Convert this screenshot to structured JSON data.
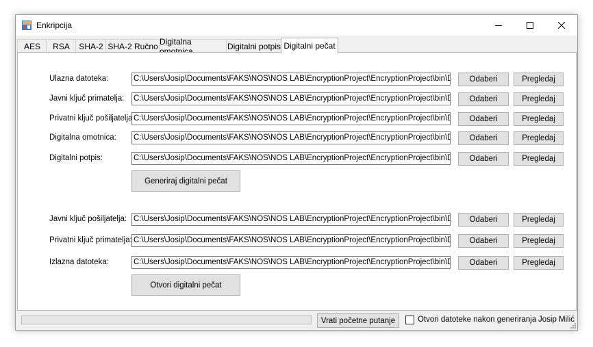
{
  "window": {
    "title": "Enkripcija"
  },
  "tabs": [
    {
      "label": "AES"
    },
    {
      "label": "RSA"
    },
    {
      "label": "SHA-2"
    },
    {
      "label": "SHA-2 Ručno"
    },
    {
      "label": "Digitalna omotnica"
    },
    {
      "label": "Digitalni potpis"
    },
    {
      "label": "Digitalni pečat"
    }
  ],
  "active_tab": "Digitalni pečat",
  "fields": [
    {
      "label": "Ulazna datoteka:",
      "value": "C:\\Users\\Josip\\Documents\\FAKS\\NOS\\NOS LAB\\EncryptionProject\\EncryptionProject\\bin\\Debug"
    },
    {
      "label": "Javni ključ primatelja:",
      "value": "C:\\Users\\Josip\\Documents\\FAKS\\NOS\\NOS LAB\\EncryptionProject\\EncryptionProject\\bin\\Debug"
    },
    {
      "label": "Privatni ključ pošiljatelja:",
      "value": "C:\\Users\\Josip\\Documents\\FAKS\\NOS\\NOS LAB\\EncryptionProject\\EncryptionProject\\bin\\Debug"
    },
    {
      "label": "Digitalna omotnica:",
      "value": "C:\\Users\\Josip\\Documents\\FAKS\\NOS\\NOS LAB\\EncryptionProject\\EncryptionProject\\bin\\Debug"
    },
    {
      "label": "Digitalni potpis:",
      "value": "C:\\Users\\Josip\\Documents\\FAKS\\NOS\\NOS LAB\\EncryptionProject\\EncryptionProject\\bin\\Debug"
    },
    {
      "label": "Javni ključ pošiljatelja:",
      "value": "C:\\Users\\Josip\\Documents\\FAKS\\NOS\\NOS LAB\\EncryptionProject\\EncryptionProject\\bin\\Debug"
    },
    {
      "label": "Privatni ključ primatelja:",
      "value": "C:\\Users\\Josip\\Documents\\FAKS\\NOS\\NOS LAB\\EncryptionProject\\EncryptionProject\\bin\\Debug"
    },
    {
      "label": "Izlazna datoteka:",
      "value": "C:\\Users\\Josip\\Documents\\FAKS\\NOS\\NOS LAB\\EncryptionProject\\EncryptionProject\\bin\\Debug"
    }
  ],
  "buttons": {
    "browse": "Odaberi",
    "view": "Pregledaj",
    "generate": "Generiraj digitalni pečat",
    "open": "Otvori digitalni pečat",
    "reset": "Vrati početne putanje"
  },
  "status": {
    "progress": 0,
    "checkbox_label": "Otvori datoteke nakon generiranja",
    "checkbox_checked": false,
    "author": "Josip Milić"
  },
  "colors": {
    "progress_fill": "#06b025",
    "window_bg": "#f0f0f0"
  }
}
